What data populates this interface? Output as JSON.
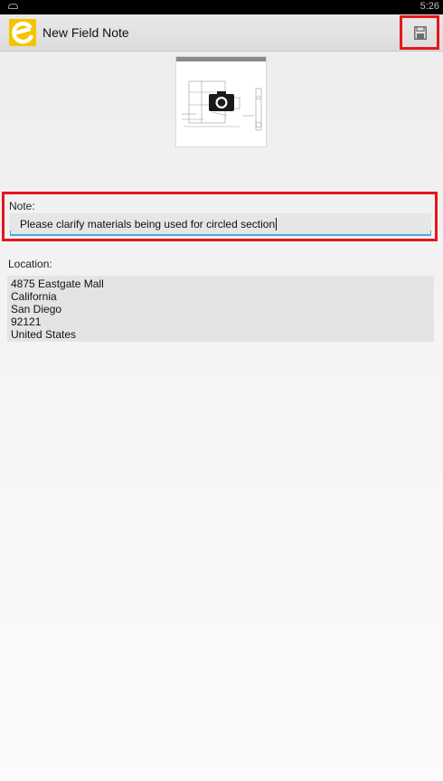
{
  "status_bar": {
    "time": "5:26",
    "notification_icon": "android-notification-icon"
  },
  "action_bar": {
    "title": "New Field Note",
    "logo_icon": "app-logo-e-icon",
    "save_icon": "floppy-disk-save-icon"
  },
  "photo": {
    "icon": "camera-icon"
  },
  "note": {
    "label": "Note:",
    "value": "Please clarify materials being used for circled section"
  },
  "location": {
    "label": "Location:",
    "lines": [
      "4875 Eastgate Mall",
      "California",
      "San Diego",
      "92121",
      "United States"
    ]
  },
  "colors": {
    "accent": "#4aa9d9",
    "logo_yellow": "#f5c400",
    "highlight": "#e8151c"
  }
}
